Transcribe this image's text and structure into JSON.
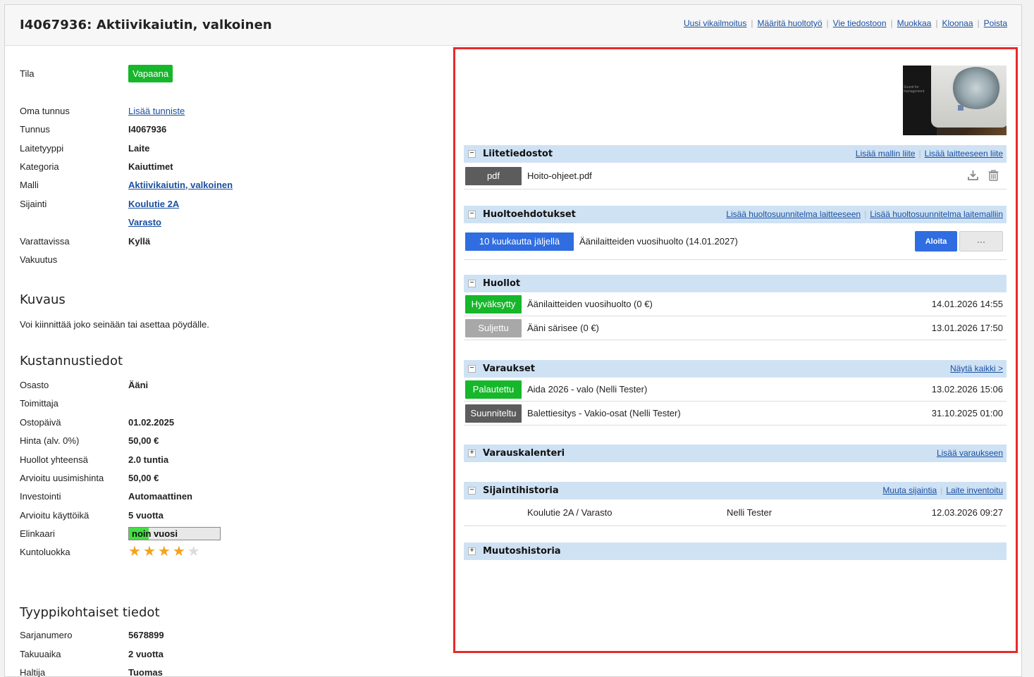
{
  "header": {
    "title": "I4067936: Aktiivikaiutin, valkoinen",
    "actions": [
      "Uusi vikailmoitus",
      "Määritä huoltotyö",
      "Vie tiedostoon",
      "Muokkaa",
      "Kloonaa",
      "Poista"
    ]
  },
  "details": {
    "tila_label": "Tila",
    "tila_value": "Vapaana",
    "oma_tunnus_label": "Oma tunnus",
    "oma_tunnus_link": "Lisää tunniste",
    "tunnus_label": "Tunnus",
    "tunnus_value": "I4067936",
    "laitetyyppi_label": "Laitetyyppi",
    "laitetyyppi_value": "Laite",
    "kategoria_label": "Kategoria",
    "kategoria_value": "Kaiuttimet",
    "malli_label": "Malli",
    "malli_value": "Aktiivikaiutin, valkoinen",
    "sijainti_label": "Sijainti",
    "sijainti_value": "Koulutie 2A",
    "sijainti_value2": "Varasto",
    "varattavissa_label": "Varattavissa",
    "varattavissa_value": "Kyllä",
    "vakuutus_label": "Vakuutus"
  },
  "kuvaus": {
    "heading": "Kuvaus",
    "text": "Voi kiinnittää joko seinään tai asettaa pöydälle."
  },
  "kustannus": {
    "heading": "Kustannustiedot",
    "rows": [
      {
        "label": "Osasto",
        "value": "Ääni"
      },
      {
        "label": "Toimittaja",
        "value": ""
      },
      {
        "label": "Ostopäivä",
        "value": "01.02.2025"
      },
      {
        "label": "Hinta (alv. 0%)",
        "value": "50,00 €"
      },
      {
        "label": "Huollot yhteensä",
        "value": "2.0 tuntia"
      },
      {
        "label": "Arvioitu uusimishinta",
        "value": "50,00 €"
      },
      {
        "label": "Investointi",
        "value": "Automaattinen"
      },
      {
        "label": "Arvioitu käyttöikä",
        "value": "5 vuotta"
      }
    ],
    "elinkaari_label": "Elinkaari",
    "elinkaari_text": "noin vuosi",
    "elinkaari_fraction": 0.22,
    "kuntoluokka_label": "Kuntoluokka",
    "kuntoluokka_rating": 4,
    "kuntoluokka_max": 5
  },
  "tyyppi": {
    "heading": "Tyyppikohtaiset tiedot",
    "rows": [
      {
        "label": "Sarjanumero",
        "value": "5678899"
      },
      {
        "label": "Takuuaika",
        "value": "2 vuotta"
      },
      {
        "label": "Haltija",
        "value": "Tuomas"
      }
    ]
  },
  "liitetiedostot": {
    "title": "Liitetiedostot",
    "links": [
      "Lisää mallin liite",
      "Lisää laitteeseen liite"
    ],
    "file_badge": "pdf",
    "file_name": "Hoito-ohjeet.pdf"
  },
  "huoltoehdotukset": {
    "title": "Huoltoehdotukset",
    "links": [
      "Lisää huoltosuunnitelma laitteeseen",
      "Lisää huoltosuunnitelma laitemalliin"
    ],
    "badge": "10 kuukautta jäljellä",
    "text": "Äänilaitteiden vuosihuolto (14.01.2027)",
    "start_button": "Aloita",
    "more_button": "···"
  },
  "huollot": {
    "title": "Huollot",
    "items": [
      {
        "badge": "Hyväksytty",
        "text": "Äänilaitteiden vuosihuolto (0 €)",
        "date": "14.01.2026 14:55"
      },
      {
        "badge": "Suljettu",
        "text": "Ääni särisee (0 €)",
        "date": "13.01.2026 17:50"
      }
    ]
  },
  "varaukset": {
    "title": "Varaukset",
    "link": "Näytä kaikki >",
    "items": [
      {
        "badge": "Palautettu",
        "text": "Aida 2026 - valo (Nelli Tester)",
        "date": "13.02.2026 15:06"
      },
      {
        "badge": "Suunniteltu",
        "text": "Balettiesitys - Vakio-osat (Nelli Tester)",
        "date": "31.10.2025 01:00"
      }
    ]
  },
  "varauskalenteri": {
    "title": "Varauskalenteri",
    "link": "Lisää varaukseen"
  },
  "sijaintihistoria": {
    "title": "Sijaintihistoria",
    "links": [
      "Muuta sijaintia",
      "Laite inventoitu"
    ],
    "location": "Koulutie 2A / Varasto",
    "user": "Nelli Tester",
    "date": "12.03.2026 09:27"
  },
  "muutoshistoria": {
    "title": "Muutoshistoria"
  },
  "thumbnail": {
    "caption": "Sound for\nmanagement."
  },
  "colors": {
    "accent_green": "#16b72a",
    "accent_blue": "#2f6de1",
    "section_header": "#cfe2f4",
    "highlight_border": "#e52b2b"
  },
  "icons": {
    "download": "download-icon",
    "delete": "trash-icon",
    "collapse": "minus-toggle-icon",
    "expand": "plus-toggle-icon",
    "star": "star-icon"
  }
}
